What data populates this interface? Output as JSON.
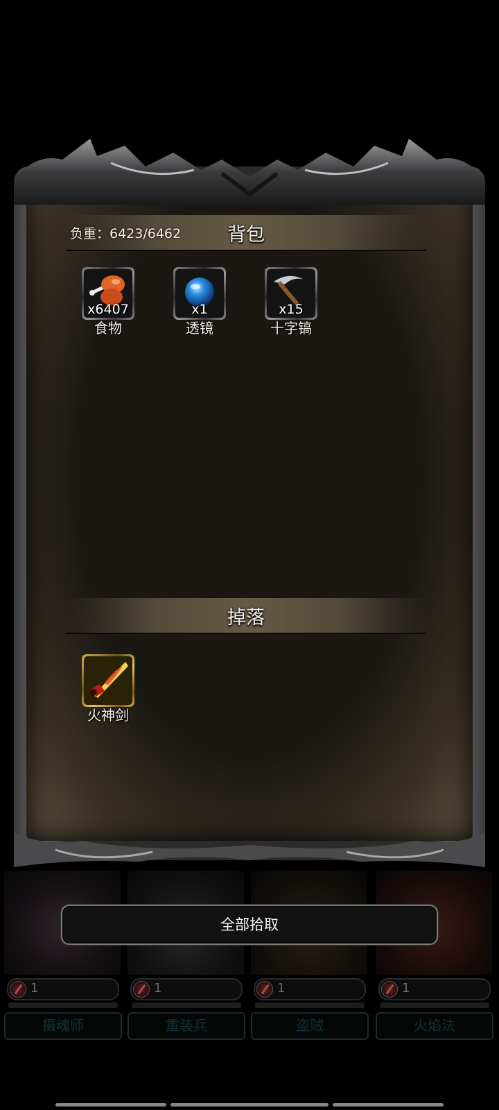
{
  "inventory": {
    "title": "背包",
    "load_label": "负重：6423/6462",
    "items": [
      {
        "name": "食物",
        "qty": "x6407",
        "icon": "roast-chicken-icon"
      },
      {
        "name": "透镜",
        "qty": "x1",
        "icon": "blue-orb-icon"
      },
      {
        "name": "十字镐",
        "qty": "x15",
        "icon": "pickaxe-icon"
      }
    ]
  },
  "drops": {
    "title": "掉落",
    "items": [
      {
        "name": "火神剑",
        "icon": "fire-sword-icon"
      }
    ]
  },
  "pickup_all_label": "全部拾取",
  "party": [
    {
      "hp": "1",
      "name": "摄魂师"
    },
    {
      "hp": "1",
      "name": "重装兵"
    },
    {
      "hp": "1",
      "name": "盗贼"
    },
    {
      "hp": "1",
      "name": "火焰法"
    }
  ],
  "colors": {
    "background": "#000000",
    "panel": "#1b1814",
    "gold_frame": "#d7b24a"
  }
}
